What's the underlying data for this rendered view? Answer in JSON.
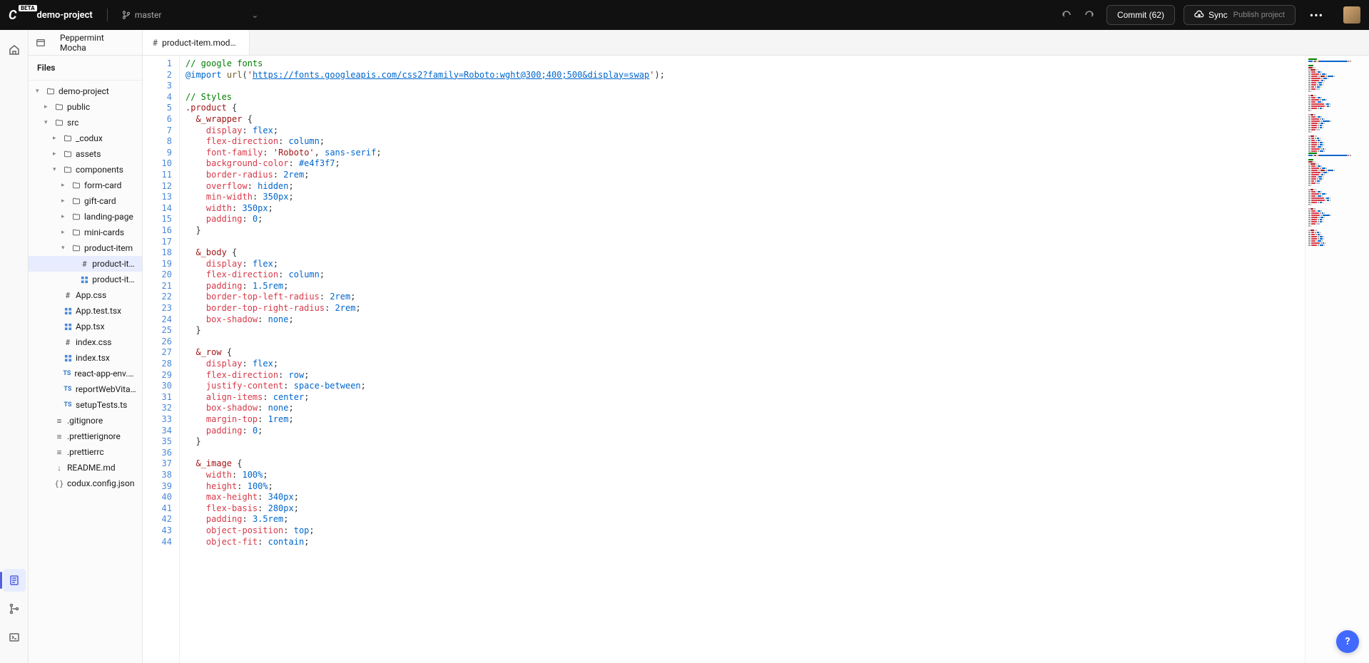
{
  "topbar": {
    "beta": "BETA",
    "project": "demo-project",
    "branch": "master",
    "commit_label": "Commit (62)",
    "sync_label": "Sync",
    "sync_sub": "Publish project"
  },
  "home": {
    "tab_label": "Peppermint Mocha"
  },
  "sidebar": {
    "header": "Files"
  },
  "tree": [
    {
      "indent": 0,
      "chev": "down",
      "icon": "folder",
      "label": "demo-project"
    },
    {
      "indent": 1,
      "chev": "right",
      "icon": "folder",
      "label": "public"
    },
    {
      "indent": 1,
      "chev": "down",
      "icon": "folder",
      "label": "src"
    },
    {
      "indent": 2,
      "chev": "right",
      "icon": "folder",
      "label": "_codux"
    },
    {
      "indent": 2,
      "chev": "right",
      "icon": "folder",
      "label": "assets"
    },
    {
      "indent": 2,
      "chev": "down",
      "icon": "folder",
      "label": "components"
    },
    {
      "indent": 3,
      "chev": "right",
      "icon": "folder",
      "label": "form-card"
    },
    {
      "indent": 3,
      "chev": "right",
      "icon": "folder",
      "label": "gift-card"
    },
    {
      "indent": 3,
      "chev": "right",
      "icon": "folder",
      "label": "landing-page"
    },
    {
      "indent": 3,
      "chev": "right",
      "icon": "folder",
      "label": "mini-cards"
    },
    {
      "indent": 3,
      "chev": "down",
      "icon": "folder",
      "label": "product-item"
    },
    {
      "indent": 4,
      "chev": "",
      "icon": "hash",
      "label": "product-ite…",
      "selected": true
    },
    {
      "indent": 4,
      "chev": "",
      "icon": "grid",
      "label": "product-ite…"
    },
    {
      "indent": 2,
      "chev": "",
      "icon": "hash",
      "label": "App.css"
    },
    {
      "indent": 2,
      "chev": "",
      "icon": "grid",
      "label": "App.test.tsx"
    },
    {
      "indent": 2,
      "chev": "",
      "icon": "grid",
      "label": "App.tsx"
    },
    {
      "indent": 2,
      "chev": "",
      "icon": "hash",
      "label": "index.css"
    },
    {
      "indent": 2,
      "chev": "",
      "icon": "grid",
      "label": "index.tsx"
    },
    {
      "indent": 2,
      "chev": "",
      "icon": "ts",
      "label": "react-app-env.d.ts"
    },
    {
      "indent": 2,
      "chev": "",
      "icon": "ts",
      "label": "reportWebVital…"
    },
    {
      "indent": 2,
      "chev": "",
      "icon": "ts",
      "label": "setupTests.ts"
    },
    {
      "indent": 1,
      "chev": "",
      "icon": "file",
      "label": ".gitignore"
    },
    {
      "indent": 1,
      "chev": "",
      "icon": "file",
      "label": ".prettierignore"
    },
    {
      "indent": 1,
      "chev": "",
      "icon": "file",
      "label": ".prettierrc"
    },
    {
      "indent": 1,
      "chev": "",
      "icon": "down",
      "label": "README.md"
    },
    {
      "indent": 1,
      "chev": "",
      "icon": "json",
      "label": "codux.config.json"
    }
  ],
  "editor": {
    "tab_label": "product-item.module…",
    "lines": [
      {
        "n": 1,
        "t": [
          {
            "c": "comment",
            "s": "// google fonts"
          }
        ]
      },
      {
        "n": 2,
        "t": [
          {
            "c": "keyword",
            "s": "@import"
          },
          {
            "c": "punc",
            "s": " "
          },
          {
            "c": "func",
            "s": "url"
          },
          {
            "c": "punc",
            "s": "("
          },
          {
            "c": "string",
            "s": "'"
          },
          {
            "c": "url",
            "s": "https://fonts.googleapis.com/css2?family=Roboto:wght@300;400;500&display=swap"
          },
          {
            "c": "string",
            "s": "'"
          },
          {
            "c": "punc",
            "s": ");"
          }
        ]
      },
      {
        "n": 3,
        "t": []
      },
      {
        "n": 4,
        "t": [
          {
            "c": "comment",
            "s": "// Styles"
          }
        ]
      },
      {
        "n": 5,
        "t": [
          {
            "c": "selector",
            "s": ".product"
          },
          {
            "c": "punc",
            "s": " "
          },
          {
            "c": "brace",
            "s": "{"
          }
        ]
      },
      {
        "n": 6,
        "t": [
          {
            "c": "punc",
            "s": "  "
          },
          {
            "c": "selector",
            "s": "&_wrapper"
          },
          {
            "c": "punc",
            "s": " "
          },
          {
            "c": "brace",
            "s": "{"
          }
        ]
      },
      {
        "n": 7,
        "t": [
          {
            "c": "punc",
            "s": "    "
          },
          {
            "c": "prop",
            "s": "display"
          },
          {
            "c": "punc",
            "s": ": "
          },
          {
            "c": "value",
            "s": "flex"
          },
          {
            "c": "punc",
            "s": ";"
          }
        ]
      },
      {
        "n": 8,
        "t": [
          {
            "c": "punc",
            "s": "    "
          },
          {
            "c": "prop",
            "s": "flex-direction"
          },
          {
            "c": "punc",
            "s": ": "
          },
          {
            "c": "value",
            "s": "column"
          },
          {
            "c": "punc",
            "s": ";"
          }
        ]
      },
      {
        "n": 9,
        "t": [
          {
            "c": "punc",
            "s": "    "
          },
          {
            "c": "prop",
            "s": "font-family"
          },
          {
            "c": "punc",
            "s": ": "
          },
          {
            "c": "string",
            "s": "'Roboto'"
          },
          {
            "c": "punc",
            "s": ", "
          },
          {
            "c": "value",
            "s": "sans-serif"
          },
          {
            "c": "punc",
            "s": ";"
          }
        ]
      },
      {
        "n": 10,
        "t": [
          {
            "c": "punc",
            "s": "    "
          },
          {
            "c": "prop",
            "s": "background-color"
          },
          {
            "c": "punc",
            "s": ": "
          },
          {
            "c": "value",
            "s": "#e4f3f7"
          },
          {
            "c": "punc",
            "s": ";"
          }
        ]
      },
      {
        "n": 11,
        "t": [
          {
            "c": "punc",
            "s": "    "
          },
          {
            "c": "prop",
            "s": "border-radius"
          },
          {
            "c": "punc",
            "s": ": "
          },
          {
            "c": "value",
            "s": "2rem"
          },
          {
            "c": "punc",
            "s": ";"
          }
        ]
      },
      {
        "n": 12,
        "t": [
          {
            "c": "punc",
            "s": "    "
          },
          {
            "c": "prop",
            "s": "overflow"
          },
          {
            "c": "punc",
            "s": ": "
          },
          {
            "c": "value",
            "s": "hidden"
          },
          {
            "c": "punc",
            "s": ";"
          }
        ]
      },
      {
        "n": 13,
        "t": [
          {
            "c": "punc",
            "s": "    "
          },
          {
            "c": "prop",
            "s": "min-width"
          },
          {
            "c": "punc",
            "s": ": "
          },
          {
            "c": "value",
            "s": "350px"
          },
          {
            "c": "punc",
            "s": ";"
          }
        ]
      },
      {
        "n": 14,
        "t": [
          {
            "c": "punc",
            "s": "    "
          },
          {
            "c": "prop",
            "s": "width"
          },
          {
            "c": "punc",
            "s": ": "
          },
          {
            "c": "value",
            "s": "350px"
          },
          {
            "c": "punc",
            "s": ";"
          }
        ]
      },
      {
        "n": 15,
        "t": [
          {
            "c": "punc",
            "s": "    "
          },
          {
            "c": "prop",
            "s": "padding"
          },
          {
            "c": "punc",
            "s": ": "
          },
          {
            "c": "value",
            "s": "0"
          },
          {
            "c": "punc",
            "s": ";"
          }
        ]
      },
      {
        "n": 16,
        "t": [
          {
            "c": "punc",
            "s": "  "
          },
          {
            "c": "brace",
            "s": "}"
          }
        ]
      },
      {
        "n": 17,
        "t": []
      },
      {
        "n": 18,
        "t": [
          {
            "c": "punc",
            "s": "  "
          },
          {
            "c": "selector",
            "s": "&_body"
          },
          {
            "c": "punc",
            "s": " "
          },
          {
            "c": "brace",
            "s": "{"
          }
        ]
      },
      {
        "n": 19,
        "t": [
          {
            "c": "punc",
            "s": "    "
          },
          {
            "c": "prop",
            "s": "display"
          },
          {
            "c": "punc",
            "s": ": "
          },
          {
            "c": "value",
            "s": "flex"
          },
          {
            "c": "punc",
            "s": ";"
          }
        ]
      },
      {
        "n": 20,
        "t": [
          {
            "c": "punc",
            "s": "    "
          },
          {
            "c": "prop",
            "s": "flex-direction"
          },
          {
            "c": "punc",
            "s": ": "
          },
          {
            "c": "value",
            "s": "column"
          },
          {
            "c": "punc",
            "s": ";"
          }
        ]
      },
      {
        "n": 21,
        "t": [
          {
            "c": "punc",
            "s": "    "
          },
          {
            "c": "prop",
            "s": "padding"
          },
          {
            "c": "punc",
            "s": ": "
          },
          {
            "c": "value",
            "s": "1.5rem"
          },
          {
            "c": "punc",
            "s": ";"
          }
        ]
      },
      {
        "n": 22,
        "t": [
          {
            "c": "punc",
            "s": "    "
          },
          {
            "c": "prop",
            "s": "border-top-left-radius"
          },
          {
            "c": "punc",
            "s": ": "
          },
          {
            "c": "value",
            "s": "2rem"
          },
          {
            "c": "punc",
            "s": ";"
          }
        ]
      },
      {
        "n": 23,
        "t": [
          {
            "c": "punc",
            "s": "    "
          },
          {
            "c": "prop",
            "s": "border-top-right-radius"
          },
          {
            "c": "punc",
            "s": ": "
          },
          {
            "c": "value",
            "s": "2rem"
          },
          {
            "c": "punc",
            "s": ";"
          }
        ]
      },
      {
        "n": 24,
        "t": [
          {
            "c": "punc",
            "s": "    "
          },
          {
            "c": "prop",
            "s": "box-shadow"
          },
          {
            "c": "punc",
            "s": ": "
          },
          {
            "c": "value",
            "s": "none"
          },
          {
            "c": "punc",
            "s": ";"
          }
        ]
      },
      {
        "n": 25,
        "t": [
          {
            "c": "punc",
            "s": "  "
          },
          {
            "c": "brace",
            "s": "}"
          }
        ]
      },
      {
        "n": 26,
        "t": []
      },
      {
        "n": 27,
        "t": [
          {
            "c": "punc",
            "s": "  "
          },
          {
            "c": "selector",
            "s": "&_row"
          },
          {
            "c": "punc",
            "s": " "
          },
          {
            "c": "brace",
            "s": "{"
          }
        ]
      },
      {
        "n": 28,
        "t": [
          {
            "c": "punc",
            "s": "    "
          },
          {
            "c": "prop",
            "s": "display"
          },
          {
            "c": "punc",
            "s": ": "
          },
          {
            "c": "value",
            "s": "flex"
          },
          {
            "c": "punc",
            "s": ";"
          }
        ]
      },
      {
        "n": 29,
        "t": [
          {
            "c": "punc",
            "s": "    "
          },
          {
            "c": "prop",
            "s": "flex-direction"
          },
          {
            "c": "punc",
            "s": ": "
          },
          {
            "c": "value",
            "s": "row"
          },
          {
            "c": "punc",
            "s": ";"
          }
        ]
      },
      {
        "n": 30,
        "t": [
          {
            "c": "punc",
            "s": "    "
          },
          {
            "c": "prop",
            "s": "justify-content"
          },
          {
            "c": "punc",
            "s": ": "
          },
          {
            "c": "value",
            "s": "space-between"
          },
          {
            "c": "punc",
            "s": ";"
          }
        ]
      },
      {
        "n": 31,
        "t": [
          {
            "c": "punc",
            "s": "    "
          },
          {
            "c": "prop",
            "s": "align-items"
          },
          {
            "c": "punc",
            "s": ": "
          },
          {
            "c": "value",
            "s": "center"
          },
          {
            "c": "punc",
            "s": ";"
          }
        ]
      },
      {
        "n": 32,
        "t": [
          {
            "c": "punc",
            "s": "    "
          },
          {
            "c": "prop",
            "s": "box-shadow"
          },
          {
            "c": "punc",
            "s": ": "
          },
          {
            "c": "value",
            "s": "none"
          },
          {
            "c": "punc",
            "s": ";"
          }
        ]
      },
      {
        "n": 33,
        "t": [
          {
            "c": "punc",
            "s": "    "
          },
          {
            "c": "prop",
            "s": "margin-top"
          },
          {
            "c": "punc",
            "s": ": "
          },
          {
            "c": "value",
            "s": "1rem"
          },
          {
            "c": "punc",
            "s": ";"
          }
        ]
      },
      {
        "n": 34,
        "t": [
          {
            "c": "punc",
            "s": "    "
          },
          {
            "c": "prop",
            "s": "padding"
          },
          {
            "c": "punc",
            "s": ": "
          },
          {
            "c": "value",
            "s": "0"
          },
          {
            "c": "punc",
            "s": ";"
          }
        ]
      },
      {
        "n": 35,
        "t": [
          {
            "c": "punc",
            "s": "  "
          },
          {
            "c": "brace",
            "s": "}"
          }
        ]
      },
      {
        "n": 36,
        "t": []
      },
      {
        "n": 37,
        "t": [
          {
            "c": "punc",
            "s": "  "
          },
          {
            "c": "selector",
            "s": "&_image"
          },
          {
            "c": "punc",
            "s": " "
          },
          {
            "c": "brace",
            "s": "{"
          }
        ]
      },
      {
        "n": 38,
        "t": [
          {
            "c": "punc",
            "s": "    "
          },
          {
            "c": "prop",
            "s": "width"
          },
          {
            "c": "punc",
            "s": ": "
          },
          {
            "c": "value",
            "s": "100%"
          },
          {
            "c": "punc",
            "s": ";"
          }
        ]
      },
      {
        "n": 39,
        "t": [
          {
            "c": "punc",
            "s": "    "
          },
          {
            "c": "prop",
            "s": "height"
          },
          {
            "c": "punc",
            "s": ": "
          },
          {
            "c": "value",
            "s": "100%"
          },
          {
            "c": "punc",
            "s": ";"
          }
        ]
      },
      {
        "n": 40,
        "t": [
          {
            "c": "punc",
            "s": "    "
          },
          {
            "c": "prop",
            "s": "max-height"
          },
          {
            "c": "punc",
            "s": ": "
          },
          {
            "c": "value",
            "s": "340px"
          },
          {
            "c": "punc",
            "s": ";"
          }
        ]
      },
      {
        "n": 41,
        "t": [
          {
            "c": "punc",
            "s": "    "
          },
          {
            "c": "prop",
            "s": "flex-basis"
          },
          {
            "c": "punc",
            "s": ": "
          },
          {
            "c": "value",
            "s": "280px"
          },
          {
            "c": "punc",
            "s": ";"
          }
        ]
      },
      {
        "n": 42,
        "t": [
          {
            "c": "punc",
            "s": "    "
          },
          {
            "c": "prop",
            "s": "padding"
          },
          {
            "c": "punc",
            "s": ": "
          },
          {
            "c": "value",
            "s": "3.5rem"
          },
          {
            "c": "punc",
            "s": ";"
          }
        ]
      },
      {
        "n": 43,
        "t": [
          {
            "c": "punc",
            "s": "    "
          },
          {
            "c": "prop",
            "s": "object-position"
          },
          {
            "c": "punc",
            "s": ": "
          },
          {
            "c": "value",
            "s": "top"
          },
          {
            "c": "punc",
            "s": ";"
          }
        ]
      },
      {
        "n": 44,
        "t": [
          {
            "c": "punc",
            "s": "    "
          },
          {
            "c": "prop",
            "s": "object-fit"
          },
          {
            "c": "punc",
            "s": ": "
          },
          {
            "c": "value",
            "s": "contain"
          },
          {
            "c": "punc",
            "s": ";"
          }
        ]
      }
    ]
  },
  "help": "?"
}
